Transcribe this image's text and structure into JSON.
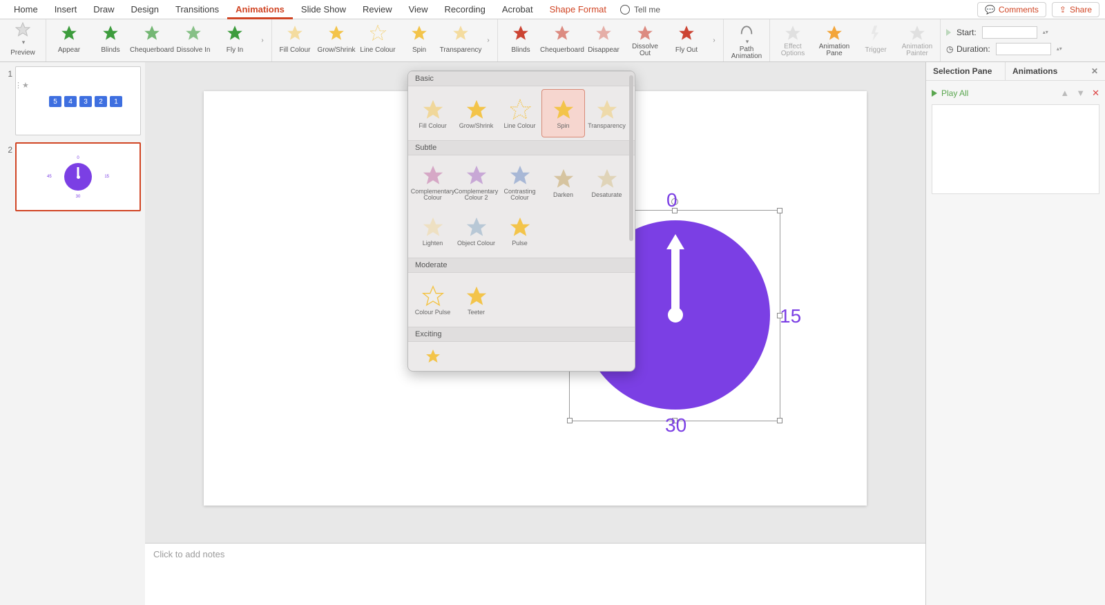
{
  "tabs": [
    "Home",
    "Insert",
    "Draw",
    "Design",
    "Transitions",
    "Animations",
    "Slide Show",
    "Review",
    "View",
    "Recording",
    "Acrobat",
    "Shape Format"
  ],
  "active_tab": "Animations",
  "tellme": "Tell me",
  "comments": "Comments",
  "share": "Share",
  "ribbon": {
    "preview": "Preview",
    "entrance": [
      "Appear",
      "Blinds",
      "Chequerboard",
      "Dissolve In",
      "Fly In"
    ],
    "emphasis": [
      "Fill Colour",
      "Grow/Shrink",
      "Line Colour",
      "Spin",
      "Transparency"
    ],
    "exit": [
      "Blinds",
      "Chequerboard",
      "Disappear",
      "Dissolve Out",
      "Fly Out"
    ],
    "path": "Path Animation",
    "effect": "Effect Options",
    "pane": "Animation Pane",
    "trigger": "Trigger",
    "painter": "Animation Painter",
    "start": "Start:",
    "duration": "Duration:"
  },
  "gallery": {
    "basic": "Basic",
    "basic_items": [
      "Fill Colour",
      "Grow/Shrink",
      "Line Colour",
      "Spin",
      "Transparency"
    ],
    "basic_selected": "Spin",
    "subtle": "Subtle",
    "subtle_items": [
      "Complementary Colour",
      "Complementary Colour 2",
      "Contrasting Colour",
      "Darken",
      "Desaturate",
      "Lighten",
      "Object Colour",
      "Pulse"
    ],
    "moderate": "Moderate",
    "moderate_items": [
      "Colour Pulse",
      "Teeter"
    ],
    "exciting": "Exciting"
  },
  "thumbs": {
    "n1": "1",
    "n2": "2",
    "boxes": [
      "5",
      "4",
      "3",
      "2",
      "1"
    ]
  },
  "canvas": {
    "labels": {
      "n0": "0",
      "n15": "15",
      "n30": "30",
      "n45": "45"
    }
  },
  "side": {
    "selection": "Selection Pane",
    "animations": "Animations",
    "play": "Play All",
    "del": "✕",
    "up": "▲",
    "down": "▼"
  },
  "notes_placeholder": "Click to add notes"
}
